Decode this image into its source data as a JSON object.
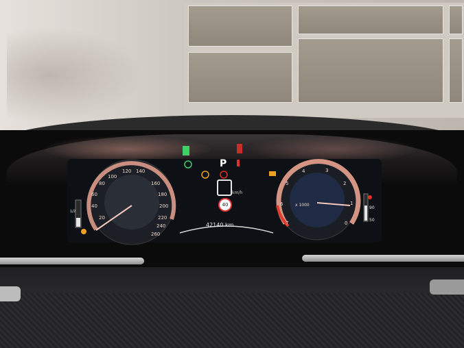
{
  "instrument_cluster": {
    "gear": "P",
    "speedometer_ticks": [
      "20",
      "40",
      "60",
      "80",
      "100",
      "120",
      "140",
      "160",
      "180",
      "200",
      "220",
      "240",
      "260"
    ],
    "tachometer_ticks": [
      "0",
      "1",
      "2",
      "3",
      "4",
      "5",
      "6",
      "7"
    ],
    "tacho_unit": "x 1000",
    "speed_unit": "km/h",
    "speed_limit": "40",
    "odometer": "42140 km",
    "temp_scale_high": "90",
    "temp_scale_low": "50",
    "fuel_scale": [
      "1/2"
    ],
    "colors": {
      "gauge_accent": "#e8a28f",
      "redline": "#e23a2a",
      "warning_amber": "#f0a020",
      "warning_red": "#e0302a",
      "indicator_green": "#3fd06a",
      "screen_bg": "#0d1014"
    },
    "icons": [
      "traction-control-icon",
      "engine-warning-icon",
      "brake-warning-icon",
      "temperature-warning-icon",
      "battery-icon",
      "door-open-icon"
    ]
  }
}
